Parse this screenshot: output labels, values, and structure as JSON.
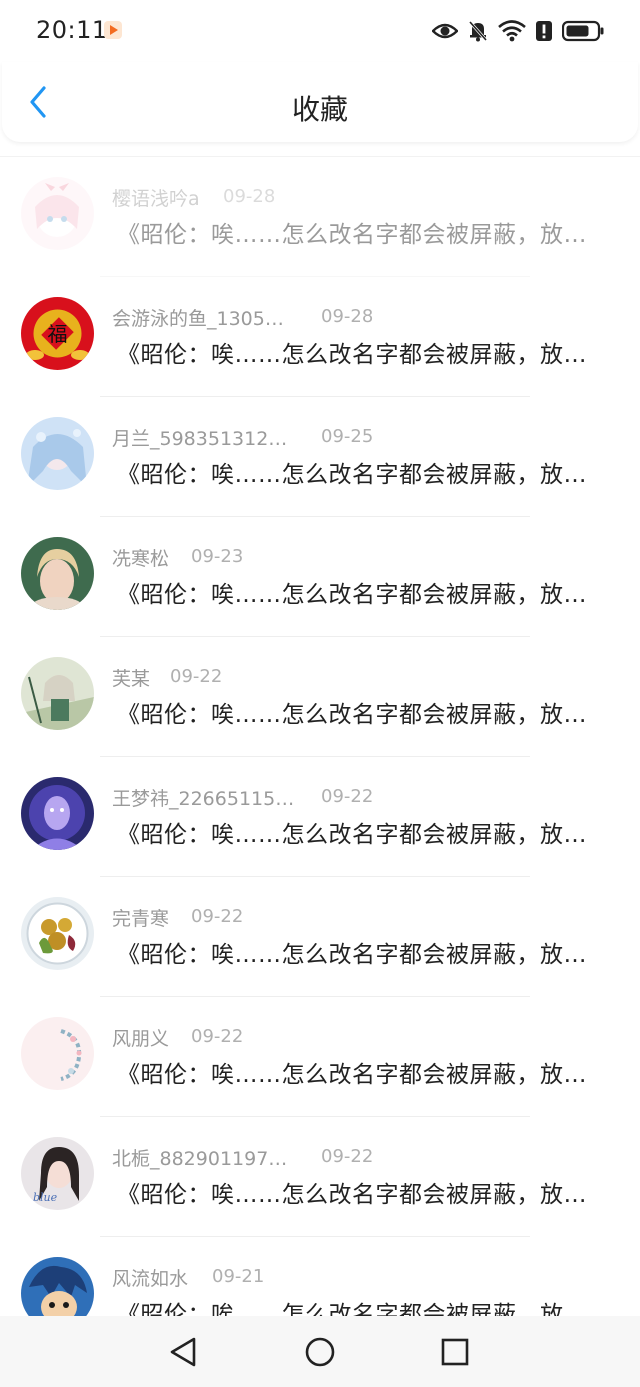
{
  "status_bar": {
    "time": "20:11",
    "icons": [
      "app-notification-icon",
      "eye-icon",
      "bell-off-icon",
      "wifi-icon",
      "alert-icon",
      "battery-icon"
    ]
  },
  "header": {
    "title": "收藏",
    "back_icon": "chevron-left-icon",
    "accent_color": "#2196f3"
  },
  "items": [
    {
      "name": "樱语浅吟a",
      "date": "09-28",
      "text": "《昭伦：唉……怎么改名字都会被屏蔽，放…",
      "avatar": "avatar-pink-anime-girl"
    },
    {
      "name": "会游泳的鱼_1305…",
      "date": "09-28",
      "text": "《昭伦：唉……怎么改名字都会被屏蔽，放…",
      "avatar": "avatar-red-fu-charm"
    },
    {
      "name": "月兰_598351312…",
      "date": "09-25",
      "text": "《昭伦：唉……怎么改名字都会被屏蔽，放…",
      "avatar": "avatar-blue-fantasy-girl"
    },
    {
      "name": "冼寒松",
      "date": "09-23",
      "text": "《昭伦：唉……怎么改名字都会被屏蔽，放…",
      "avatar": "avatar-blonde-woman"
    },
    {
      "name": "芙某",
      "date": "09-22",
      "text": "《昭伦：唉……怎么改名字都会被屏蔽，放…",
      "avatar": "avatar-anime-character"
    },
    {
      "name": "王梦祎_22665115…",
      "date": "09-22",
      "text": "《昭伦：唉……怎么改名字都会被屏蔽，放…",
      "avatar": "avatar-purple-glow-figure"
    },
    {
      "name": "完青寒",
      "date": "09-22",
      "text": "《昭伦：唉……怎么改名字都会被屏蔽，放…",
      "avatar": "avatar-salad-plate"
    },
    {
      "name": "风朋义",
      "date": "09-22",
      "text": "《昭伦：唉……怎么改名字都会被屏蔽，放…",
      "avatar": "avatar-floral-wreath"
    },
    {
      "name": "北栀_882901197…",
      "date": "09-22",
      "text": "《昭伦：唉……怎么改名字都会被屏蔽，放…",
      "avatar": "avatar-girl-blue-text"
    },
    {
      "name": "风流如水",
      "date": "09-21",
      "text": "《昭伦：唉……怎么改名字都会被屏蔽，放…",
      "avatar": "avatar-anime-boy"
    }
  ],
  "nav_bar": {
    "icons": [
      "back-triangle-icon",
      "home-circle-icon",
      "recents-square-icon"
    ]
  }
}
